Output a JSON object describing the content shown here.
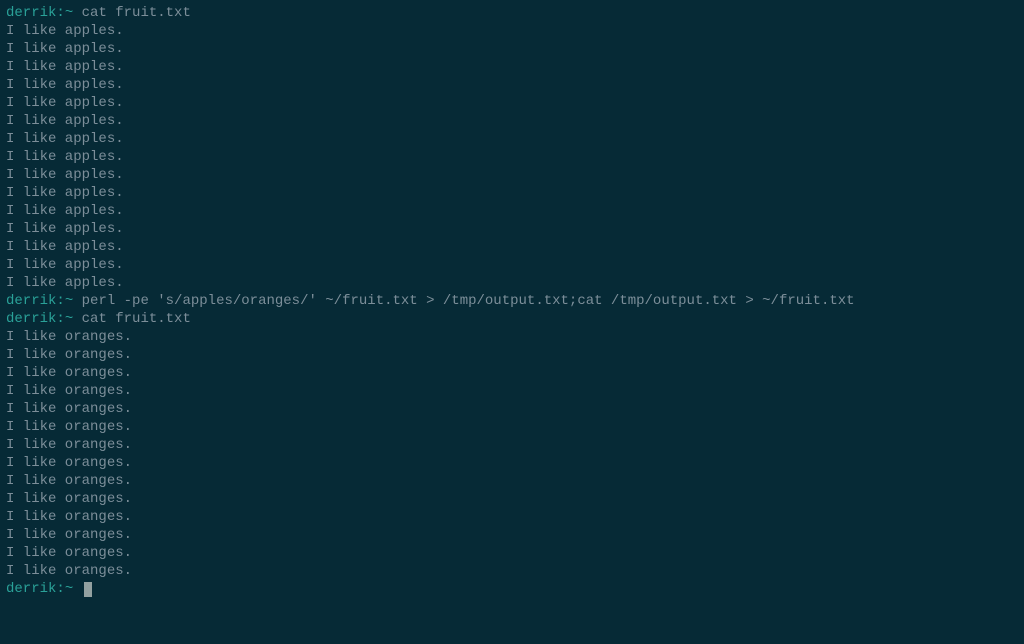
{
  "prompt": {
    "user": "derrik",
    "separator": ":",
    "path": "~",
    "symbol": " "
  },
  "blocks": [
    {
      "type": "command",
      "text": "cat fruit.txt"
    },
    {
      "type": "output",
      "lines": [
        "I like apples.",
        "I like apples.",
        "I like apples.",
        "I like apples.",
        "I like apples.",
        "I like apples.",
        "I like apples.",
        "I like apples.",
        "I like apples.",
        "I like apples.",
        "I like apples.",
        "I like apples.",
        "I like apples.",
        "I like apples.",
        "I like apples."
      ]
    },
    {
      "type": "command",
      "text": "perl -pe 's/apples/oranges/' ~/fruit.txt > /tmp/output.txt;cat /tmp/output.txt > ~/fruit.txt"
    },
    {
      "type": "command",
      "text": "cat fruit.txt"
    },
    {
      "type": "output",
      "lines": [
        "I like oranges.",
        "I like oranges.",
        "I like oranges.",
        "I like oranges.",
        "I like oranges.",
        "I like oranges.",
        "I like oranges.",
        "I like oranges.",
        "I like oranges.",
        "I like oranges.",
        "I like oranges.",
        "I like oranges.",
        "I like oranges.",
        "I like oranges."
      ]
    },
    {
      "type": "prompt-cursor"
    }
  ]
}
